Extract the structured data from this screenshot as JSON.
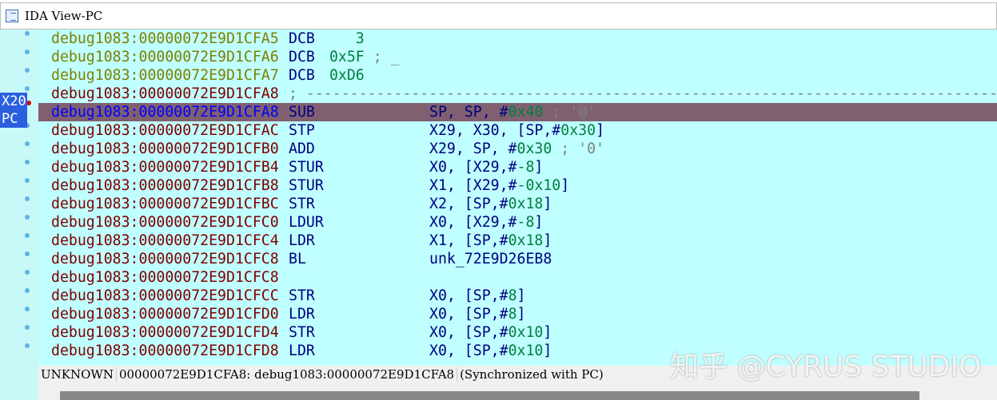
{
  "window": {
    "title": "IDA View-PC",
    "icon": "disassembly-icon"
  },
  "colors": {
    "addr_data": "#808000",
    "addr_code": "#800000",
    "addr_current": "#0000ff",
    "mnemonic": "#000080",
    "number": "#008040",
    "comment": "#808080",
    "text": "#000080"
  },
  "registers": [
    {
      "label": "X20",
      "row": 4
    },
    {
      "label": "PC",
      "row": 4
    }
  ],
  "lines": [
    {
      "addr": "debug1083:00000072E9D1CFA5",
      "kind": "data",
      "mn": "DCB",
      "op": [
        [
          "    3",
          "number"
        ]
      ]
    },
    {
      "addr": "debug1083:00000072E9D1CFA6",
      "kind": "data",
      "mn": "DCB",
      "op": [
        [
          " 0x5F",
          "number"
        ],
        [
          " ; _",
          "comment"
        ]
      ]
    },
    {
      "addr": "debug1083:00000072E9D1CFA7",
      "kind": "data",
      "mn": "DCB",
      "op": [
        [
          " 0xD6",
          "number"
        ]
      ]
    },
    {
      "addr": "debug1083:00000072E9D1CFA8",
      "kind": "code",
      "mn": "; ---------------------------------------------------------------------------------",
      "mnkind": "comment",
      "op": []
    },
    {
      "addr": "debug1083:00000072E9D1CFA8",
      "kind": "current",
      "mn": "SUB",
      "op": [
        [
          "SP, SP, #",
          "text"
        ],
        [
          "0x40",
          "number"
        ],
        [
          " ; '@'",
          "comment"
        ]
      ]
    },
    {
      "addr": "debug1083:00000072E9D1CFAC",
      "kind": "code",
      "mn": "STP",
      "op": [
        [
          "X29, X30, [SP,#",
          "text"
        ],
        [
          "0x30",
          "number"
        ],
        [
          "]",
          "text"
        ]
      ]
    },
    {
      "addr": "debug1083:00000072E9D1CFB0",
      "kind": "code",
      "mn": "ADD",
      "op": [
        [
          "X29, SP, #",
          "text"
        ],
        [
          "0x30",
          "number"
        ],
        [
          " ; '0'",
          "comment"
        ]
      ]
    },
    {
      "addr": "debug1083:00000072E9D1CFB4",
      "kind": "code",
      "mn": "STUR",
      "op": [
        [
          "X0, [X29,#",
          "text"
        ],
        [
          "-8",
          "number"
        ],
        [
          "]",
          "text"
        ]
      ]
    },
    {
      "addr": "debug1083:00000072E9D1CFB8",
      "kind": "code",
      "mn": "STUR",
      "op": [
        [
          "X1, [X29,#",
          "text"
        ],
        [
          "-0x10",
          "number"
        ],
        [
          "]",
          "text"
        ]
      ]
    },
    {
      "addr": "debug1083:00000072E9D1CFBC",
      "kind": "code",
      "mn": "STR",
      "op": [
        [
          "X2, [SP,#",
          "text"
        ],
        [
          "0x18",
          "number"
        ],
        [
          "]",
          "text"
        ]
      ]
    },
    {
      "addr": "debug1083:00000072E9D1CFC0",
      "kind": "code",
      "mn": "LDUR",
      "op": [
        [
          "X0, [X29,#",
          "text"
        ],
        [
          "-8",
          "number"
        ],
        [
          "]",
          "text"
        ]
      ]
    },
    {
      "addr": "debug1083:00000072E9D1CFC4",
      "kind": "code",
      "mn": "LDR",
      "op": [
        [
          "X1, [SP,#",
          "text"
        ],
        [
          "0x18",
          "number"
        ],
        [
          "]",
          "text"
        ]
      ]
    },
    {
      "addr": "debug1083:00000072E9D1CFC8",
      "kind": "code",
      "mn": "BL",
      "op": [
        [
          "unk_72E9D26EB8",
          "text"
        ]
      ]
    },
    {
      "addr": "debug1083:00000072E9D1CFC8",
      "kind": "code",
      "mn": "",
      "op": []
    },
    {
      "addr": "debug1083:00000072E9D1CFCC",
      "kind": "code",
      "mn": "STR",
      "op": [
        [
          "X0, [SP,#",
          "text"
        ],
        [
          "8",
          "number"
        ],
        [
          "]",
          "text"
        ]
      ]
    },
    {
      "addr": "debug1083:00000072E9D1CFD0",
      "kind": "code",
      "mn": "LDR",
      "op": [
        [
          "X0, [SP,#",
          "text"
        ],
        [
          "8",
          "number"
        ],
        [
          "]",
          "text"
        ]
      ]
    },
    {
      "addr": "debug1083:00000072E9D1CFD4",
      "kind": "code",
      "mn": "STR",
      "op": [
        [
          "X0, [SP,#",
          "text"
        ],
        [
          "0x10",
          "number"
        ],
        [
          "]",
          "text"
        ]
      ]
    },
    {
      "addr": "debug1083:00000072E9D1CFD8",
      "kind": "code",
      "mn": "LDR",
      "op": [
        [
          "X0, [SP,#",
          "text"
        ],
        [
          "0x10",
          "number"
        ],
        [
          "]",
          "text"
        ]
      ]
    }
  ],
  "status": {
    "type": "UNKNOWN",
    "location": "00000072E9D1CFA8: debug1083:00000072E9D1CFA8",
    "sync": "(Synchronized with PC)"
  },
  "watermark": "知乎 @CYRUS STUDIO"
}
